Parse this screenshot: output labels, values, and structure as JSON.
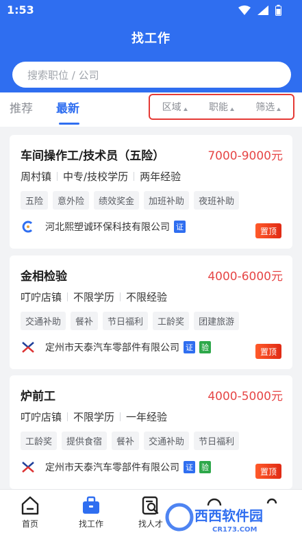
{
  "status": {
    "time": "1:53"
  },
  "header": {
    "title": "找工作",
    "search_placeholder": "搜索职位 / 公司"
  },
  "tabs": {
    "recommend": "推荐",
    "latest": "最新"
  },
  "filters": {
    "area": "区域",
    "function": "职能",
    "filter": "筛选"
  },
  "jobs": [
    {
      "title": "车间操作工/技术员（五险）",
      "salary": "7000-9000元",
      "location": "周村镇",
      "education": "中专/技校学历",
      "experience": "两年经验",
      "tags": [
        "五险",
        "意外险",
        "绩效奖金",
        "加班补助",
        "夜班补助"
      ],
      "company": "河北熙塑诚环保科技有限公司",
      "badges": [
        "证"
      ],
      "top_label": "置顶"
    },
    {
      "title": "金相检验",
      "salary": "4000-6000元",
      "location": "叮咛店镇",
      "education": "不限学历",
      "experience": "不限经验",
      "tags": [
        "交通补助",
        "餐补",
        "节日福利",
        "工龄奖",
        "团建旅游"
      ],
      "company": "定州市天泰汽车零部件有限公司",
      "badges": [
        "证",
        "验"
      ],
      "top_label": "置顶"
    },
    {
      "title": "炉前工",
      "salary": "4000-5000元",
      "location": "叮咛店镇",
      "education": "不限学历",
      "experience": "一年经验",
      "tags": [
        "工龄奖",
        "提供食宿",
        "餐补",
        "交通补助",
        "节日福利"
      ],
      "company": "定州市天泰汽车零部件有限公司",
      "badges": [
        "证",
        "验"
      ],
      "top_label": "置顶"
    }
  ],
  "nav": {
    "home": "首页",
    "jobs": "找工作",
    "talent": "找人才"
  },
  "watermark": {
    "brand": "西西软件园",
    "url": "CR173.COM"
  },
  "colors": {
    "primary": "#2f6ef0",
    "salary": "#e64646",
    "highlight_border": "#e53935"
  },
  "icons": {
    "home": "home-icon",
    "jobs": "briefcase-icon",
    "talent": "search-person-icon"
  }
}
